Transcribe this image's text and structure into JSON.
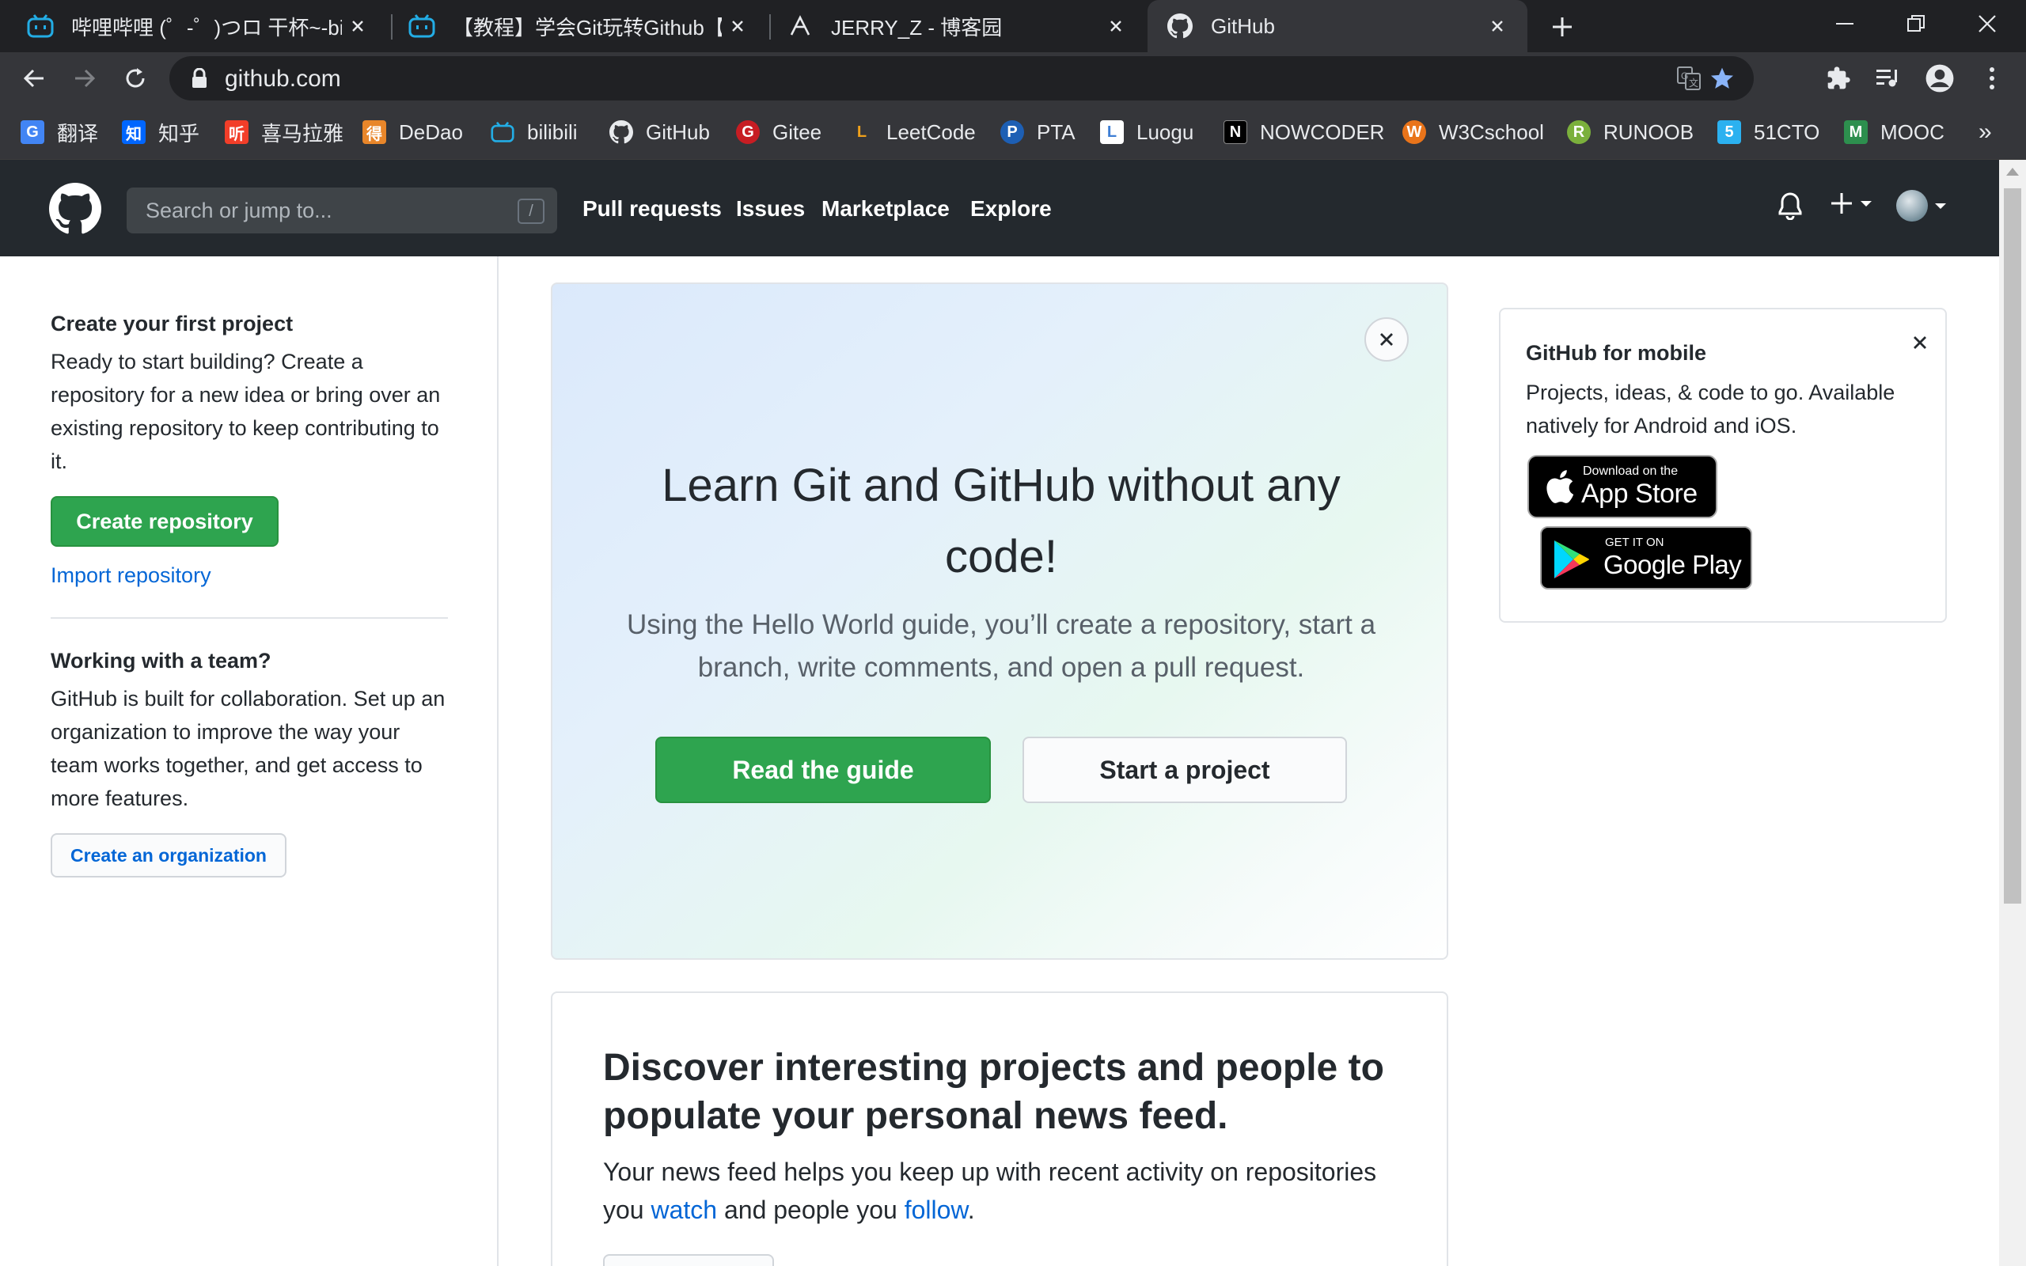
{
  "browser": {
    "tabs": [
      {
        "title": "哔哩哔哩 (゜-゜)つロ 干杯~-bilil",
        "favicon": "bilibili-icon",
        "active": false
      },
      {
        "title": "【教程】学会Git玩转Github【全",
        "favicon": "bilibili-icon",
        "active": false
      },
      {
        "title": "JERRY_Z - 博客园",
        "favicon": "cnblogs-icon",
        "active": false
      },
      {
        "title": "GitHub",
        "favicon": "github-icon",
        "active": true
      }
    ],
    "url": "github.com",
    "bookmarks": [
      {
        "label": "翻译",
        "icon": "translate-icon",
        "color": "#4285f4",
        "glyph": "G"
      },
      {
        "label": "知乎",
        "icon": "zhihu-icon",
        "color": "#0066ff",
        "glyph": "知"
      },
      {
        "label": "喜马拉雅",
        "icon": "ximalaya-icon",
        "color": "#f23e29",
        "glyph": "听"
      },
      {
        "label": "DeDao",
        "icon": "dedao-icon",
        "color": "#e8862a",
        "glyph": "得"
      },
      {
        "label": "bilibili",
        "icon": "bilibili-icon",
        "color": "#23ade5",
        "glyph": "b"
      },
      {
        "label": "GitHub",
        "icon": "github-icon",
        "color": "#ffffff",
        "glyph": ""
      },
      {
        "label": "Gitee",
        "icon": "gitee-icon",
        "color": "#c71d23",
        "glyph": "G"
      },
      {
        "label": "LeetCode",
        "icon": "leetcode-icon",
        "color": "#f0a11b",
        "glyph": "L"
      },
      {
        "label": "PTA",
        "icon": "pta-icon",
        "color": "#1d5fb4",
        "glyph": "P"
      },
      {
        "label": "Luogu",
        "icon": "luogu-icon",
        "color": "#3e7ed4",
        "glyph": "L"
      },
      {
        "label": "NOWCODER",
        "icon": "nowcoder-icon",
        "color": "#000000",
        "glyph": "N"
      },
      {
        "label": "W3Cschool",
        "icon": "w3cschool-icon",
        "color": "#e9741a",
        "glyph": "W"
      },
      {
        "label": "RUNOOB",
        "icon": "runoob-icon",
        "color": "#7bb03c",
        "glyph": "R"
      },
      {
        "label": "51CTO",
        "icon": "51cto-icon",
        "color": "#2bb1f0",
        "glyph": "5"
      },
      {
        "label": "MOOC",
        "icon": "mooc-icon",
        "color": "#2d8f4e",
        "glyph": "M"
      }
    ],
    "bookmarks_more": "»"
  },
  "header": {
    "search_placeholder": "Search or jump to...",
    "search_shortcut": "/",
    "nav": [
      "Pull requests",
      "Issues",
      "Marketplace",
      "Explore"
    ]
  },
  "sidebar": {
    "first_project": {
      "title": "Create your first project",
      "text": "Ready to start building? Create a repository for a new idea or bring over an existing repository to keep contributing to it.",
      "create_button": "Create repository",
      "import_link": "Import repository"
    },
    "team": {
      "title": "Working with a team?",
      "text": "GitHub is built for collaboration. Set up an organization to improve the way your team works together, and get access to more features.",
      "org_button": "Create an organization"
    }
  },
  "hero": {
    "title": "Learn Git and GitHub without any code!",
    "subtitle": "Using the Hello World guide, you’ll create a repository, start a branch, write comments, and open a pull request.",
    "primary_button": "Read the guide",
    "secondary_button": "Start a project"
  },
  "discover": {
    "title": "Discover interesting projects and people to populate your personal news feed.",
    "text_1": "Your news feed helps you keep up with recent activity on repositories you ",
    "watch_link": "watch",
    "text_2": " and people you ",
    "follow_link": "follow",
    "text_3": "."
  },
  "mobile": {
    "title": "GitHub for mobile",
    "text": "Projects, ideas, & code to go. Available natively for Android and iOS.",
    "appstore_small": "Download on the",
    "appstore_big": "App Store",
    "googleplay_small": "GET IT ON",
    "googleplay_big": "Google Play"
  },
  "colors": {
    "primary_green": "#2ea44f",
    "link_blue": "#0366d6",
    "header_dark": "#24292e",
    "bookmark_star": "#8ab4f8"
  }
}
